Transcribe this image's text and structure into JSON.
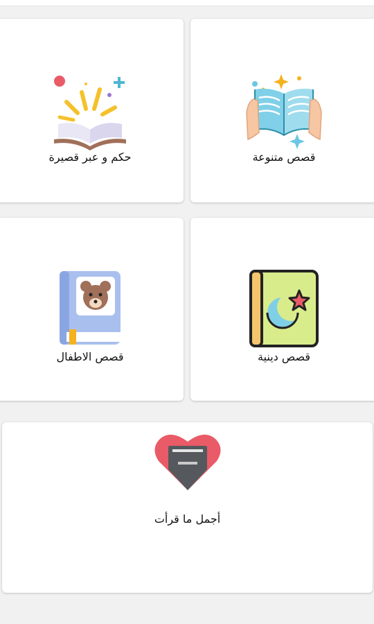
{
  "categories": [
    {
      "label": "قصص متنوعة"
    },
    {
      "label": "حكم و عبر قصيرة"
    },
    {
      "label": "قصص دينية"
    },
    {
      "label": "قصص الاطفال"
    },
    {
      "label": "أجمل ما قرأت"
    }
  ],
  "colors": {
    "background": "#f1f1f1",
    "card": "#ffffff",
    "text": "#111111",
    "book_blue": "#7fcfe6",
    "heart_red": "#e95b67",
    "kids_book_blue": "#a9c0ee",
    "religious_book_green": "#d9ec8c"
  },
  "icons": [
    "open-book-hands-icon",
    "book-sparkle-icon",
    "crescent-star-book-icon",
    "bear-book-icon",
    "heart-inbox-icon"
  ]
}
